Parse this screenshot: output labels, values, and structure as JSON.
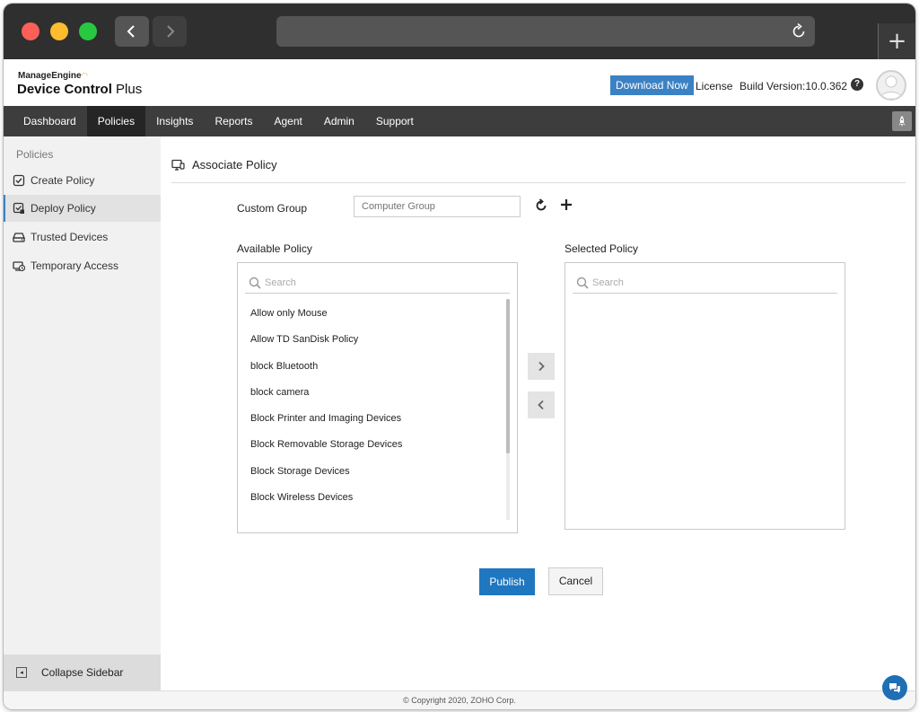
{
  "app": {
    "brand_top": "ManageEngine",
    "brand_main": "Device Control",
    "brand_plus": " Plus",
    "download_label": "Download Now",
    "license_label": "License",
    "build_version": "Build Version:10.0.362",
    "help_glyph": "?"
  },
  "nav": {
    "items": [
      {
        "label": "Dashboard"
      },
      {
        "label": "Policies"
      },
      {
        "label": "Insights"
      },
      {
        "label": "Reports"
      },
      {
        "label": "Agent"
      },
      {
        "label": "Admin"
      },
      {
        "label": "Support"
      }
    ],
    "active_index": 1
  },
  "sidebar": {
    "title": "Policies",
    "items": [
      {
        "label": "Create Policy",
        "icon": "shield-check-icon"
      },
      {
        "label": "Deploy Policy",
        "icon": "deploy-icon"
      },
      {
        "label": "Trusted Devices",
        "icon": "drive-icon"
      },
      {
        "label": "Temporary Access",
        "icon": "temporary-access-icon"
      }
    ],
    "active_index": 1,
    "collapse_label": "Collapse Sidebar"
  },
  "page": {
    "title": "Associate Policy",
    "custom_group_label": "Custom Group",
    "group_placeholder": "Computer Group",
    "available_label": "Available Policy",
    "selected_label": "Selected Policy",
    "search_placeholder": "Search",
    "available_policies": [
      "Allow only Mouse",
      "Allow TD SanDisk Policy",
      "block Bluetooth",
      "block camera",
      "Block Printer and Imaging Devices",
      "Block Removable Storage Devices",
      "Block Storage Devices",
      "Block Wireless Devices"
    ],
    "selected_policies": [],
    "publish_label": "Publish",
    "cancel_label": "Cancel"
  },
  "footer": {
    "copyright": "© Copyright 2020, ZOHO Corp."
  },
  "colors": {
    "accent": "#1f77c0",
    "nav_bg": "#3d3d3d",
    "sidebar_bg": "#f1f1f1"
  }
}
